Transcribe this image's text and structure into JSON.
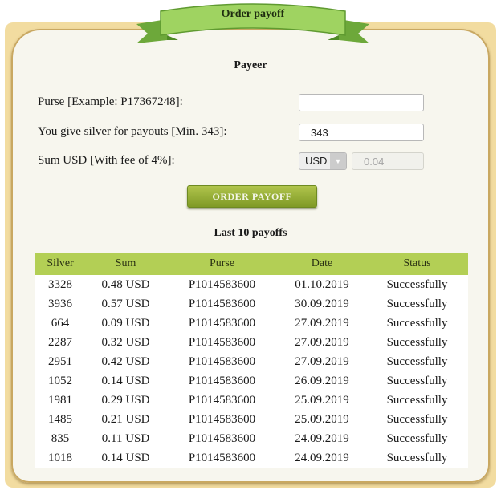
{
  "header": {
    "title": "Order payoff"
  },
  "section_title": "Payeer",
  "form": {
    "purse_label": "Purse [Example: P17367248]:",
    "purse_value": "",
    "silver_label": "You give silver for payouts [Min. 343]:",
    "silver_value": "343",
    "sum_label": "Sum USD [With fee of 4%]:",
    "currency_selected": "USD",
    "sum_value": "0.04",
    "submit_label": "ORDER PAYOFF"
  },
  "table": {
    "title": "Last 10 payoffs",
    "columns": [
      "Silver",
      "Sum",
      "Purse",
      "Date",
      "Status"
    ],
    "rows": [
      [
        "3328",
        "0.48 USD",
        "P1014583600",
        "01.10.2019",
        "Successfully"
      ],
      [
        "3936",
        "0.57 USD",
        "P1014583600",
        "30.09.2019",
        "Successfully"
      ],
      [
        "664",
        "0.09 USD",
        "P1014583600",
        "27.09.2019",
        "Successfully"
      ],
      [
        "2287",
        "0.32 USD",
        "P1014583600",
        "27.09.2019",
        "Successfully"
      ],
      [
        "2951",
        "0.42 USD",
        "P1014583600",
        "27.09.2019",
        "Successfully"
      ],
      [
        "1052",
        "0.14 USD",
        "P1014583600",
        "26.09.2019",
        "Successfully"
      ],
      [
        "1981",
        "0.29 USD",
        "P1014583600",
        "25.09.2019",
        "Successfully"
      ],
      [
        "1485",
        "0.21 USD",
        "P1014583600",
        "25.09.2019",
        "Successfully"
      ],
      [
        "835",
        "0.11 USD",
        "P1014583600",
        "24.09.2019",
        "Successfully"
      ],
      [
        "1018",
        "0.14 USD",
        "P1014583600",
        "24.09.2019",
        "Successfully"
      ]
    ]
  },
  "colors": {
    "accent": "#b3cf55",
    "button": "#8fa834",
    "frame": "#f2dca0",
    "panel": "#f7f6ee"
  }
}
